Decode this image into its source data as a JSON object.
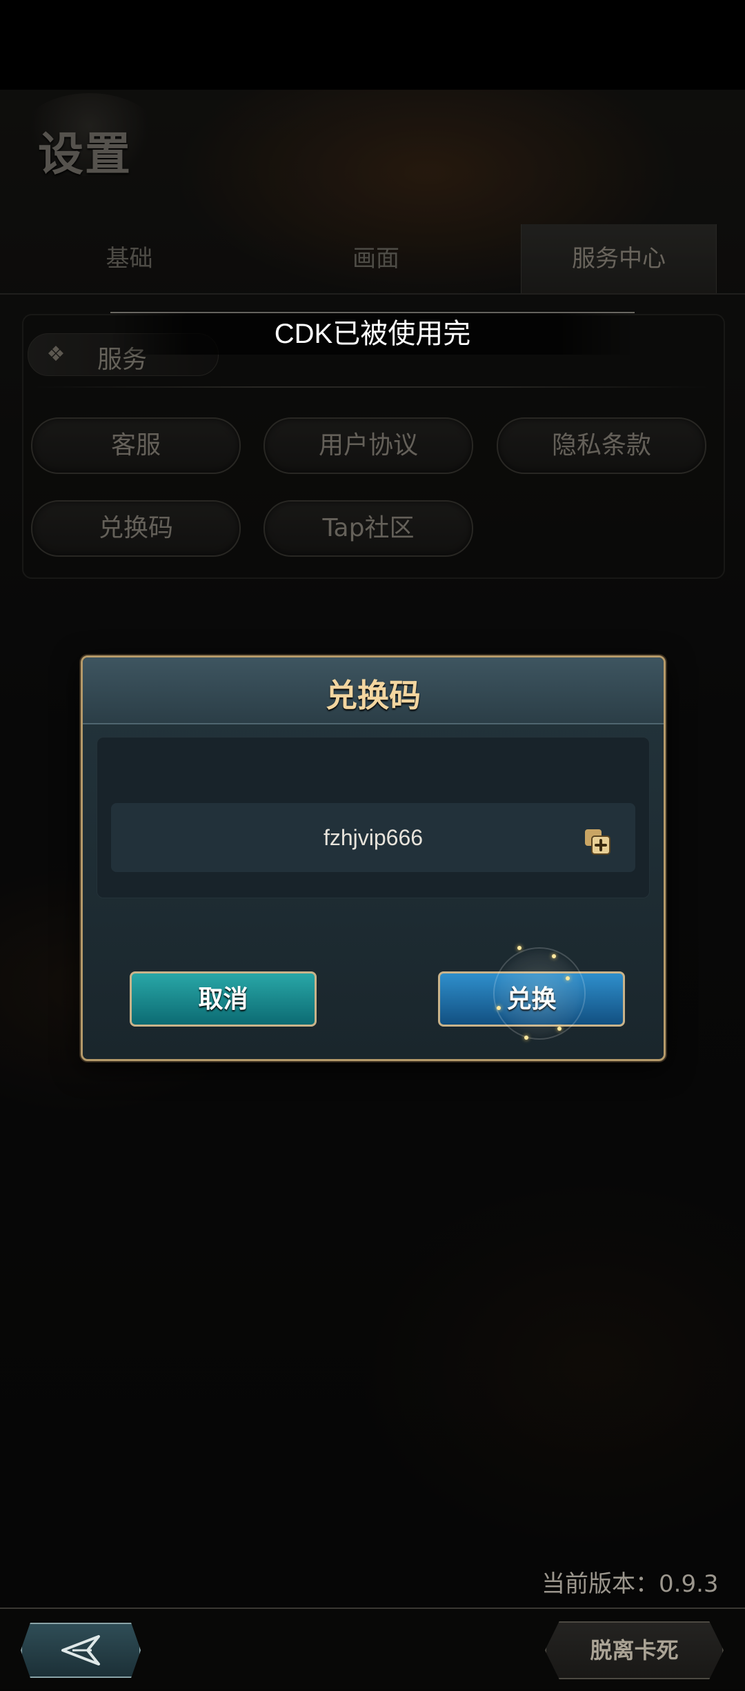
{
  "page": {
    "title": "设置"
  },
  "tabs": [
    {
      "label": "基础",
      "active": false
    },
    {
      "label": "画面",
      "active": false
    },
    {
      "label": "服务中心",
      "active": true
    }
  ],
  "service": {
    "section_label": "服务",
    "buttons": [
      "客服",
      "用户协议",
      "隐私条款",
      "兑换码",
      "Tap社区"
    ]
  },
  "toast": {
    "message": "CDK已被使用完"
  },
  "dialog": {
    "title": "兑换码",
    "code_value": "fzhjvip666",
    "cancel_label": "取消",
    "confirm_label": "兑换"
  },
  "footer": {
    "version_text": "当前版本：0.9.3",
    "stuck_label": "脱离卡死"
  },
  "icons": {
    "section": "diamond-cross-icon",
    "paste": "paste-icon",
    "back": "back-arrow-icon"
  },
  "colors": {
    "dialog_title": "#f3d6a0",
    "cancel_button": "#1a8f93",
    "confirm_button": "#1f6fa6",
    "dialog_border": "#b59a6a"
  }
}
